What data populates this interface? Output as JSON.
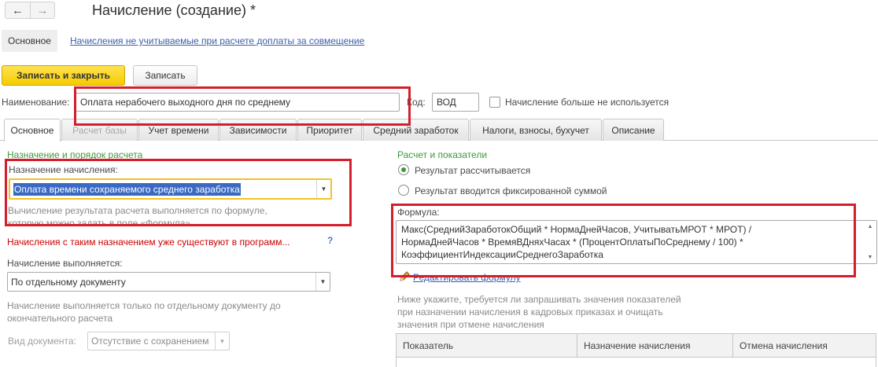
{
  "window": {
    "title": "Начисление (создание) *",
    "back_icon": "←",
    "forward_icon": "→"
  },
  "sections": {
    "active": "Основное",
    "link": "Начисления не учитываемые при расчете доплаты за совмещение"
  },
  "toolbar": {
    "save_close_label": "Записать и закрыть",
    "save_label": "Записать"
  },
  "header": {
    "name_label": "Наименование:",
    "name_value": "Оплата нерабочего выходного дня по среднему",
    "code_label": "Код:",
    "code_value": "ВОД",
    "not_used_label": "Начисление больше не используется"
  },
  "tabs": [
    {
      "label": "Основное"
    },
    {
      "label": "Расчет базы"
    },
    {
      "label": "Учет времени"
    },
    {
      "label": "Зависимости"
    },
    {
      "label": "Приоритет"
    },
    {
      "label": "Средний заработок"
    },
    {
      "label": "Налоги, взносы, бухучет"
    },
    {
      "label": "Описание"
    }
  ],
  "left": {
    "group_title": "Назначение и порядок расчета",
    "purpose_label": "Назначение начисления:",
    "purpose_value": "Оплата времени сохраняемого среднего заработка",
    "hint_line1": "Вычисление результата расчета выполняется по формуле,",
    "hint_line2": "которую можно задать в поле «Формула»",
    "warning": "Начисления с таким назначением уже существуют в программ...",
    "help": "?",
    "performed_label": "Начисление выполняется:",
    "performed_value": "По отдельному документу",
    "performed_hint_line1": "Начисление выполняется только по отдельному документу до",
    "performed_hint_line2": "окончательного расчета",
    "doc_type_label": "Вид документа:",
    "doc_type_value": "Отсутствие с сохранением"
  },
  "right": {
    "group_title": "Расчет и показатели",
    "radio_calculated": "Результат рассчитывается",
    "radio_fixed": "Результат вводится фиксированной суммой",
    "formula_label": "Формула:",
    "formula_line1": "Макс(СреднийЗаработокОбщий * НормаДнейЧасов, УчитыватьМРОТ * МРОТ) /",
    "formula_line2": "НормаДнейЧасов * ВремяВДняхЧасах * (ПроцентОплатыПоСреднему / 100) *",
    "formula_line3": "КоэффициентИндексацииСреднегоЗаработка",
    "edit_formula": "Редактировать формулу",
    "indicators_hint_line1": "Ниже укажите, требуется ли запрашивать значения показателей",
    "indicators_hint_line2": "при назначении начисления в кадровых приказах и очищать",
    "indicators_hint_line3": "значения при отмене начисления",
    "table_headers": [
      "Показатель",
      "Назначение начисления",
      "Отмена начисления"
    ]
  },
  "colors": {
    "accent_yellow": "#f5cb00",
    "highlight_red": "#d31f2b",
    "group_green": "#3c9a3c",
    "link_blue": "#3d5da8",
    "selection_blue": "#3a69c4"
  }
}
